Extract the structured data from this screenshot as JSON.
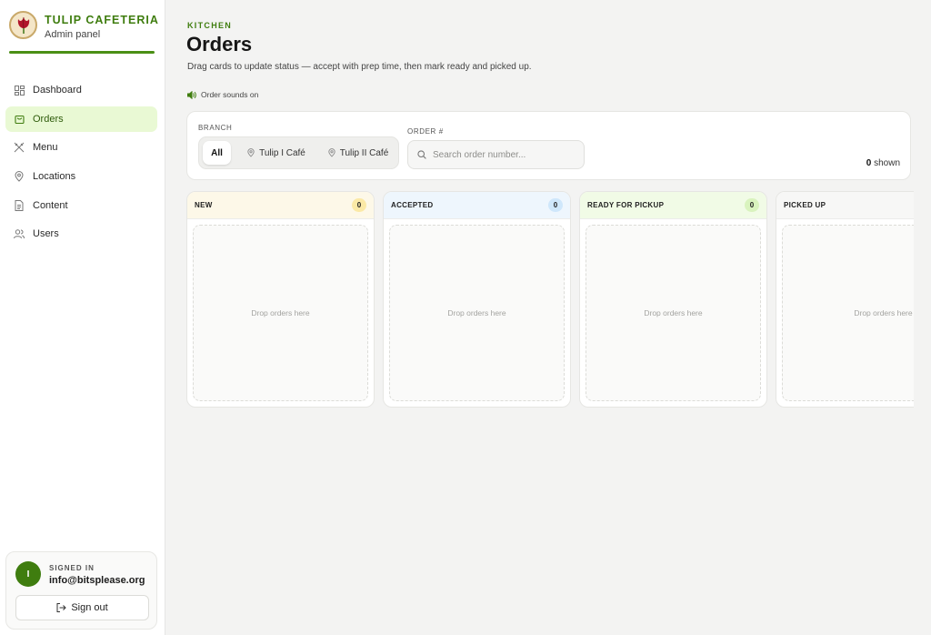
{
  "brand": {
    "name": "TULIP CAFETERIA",
    "subtitle": "Admin panel"
  },
  "nav": [
    {
      "label": "Dashboard",
      "icon": "dashboard-icon",
      "active": false
    },
    {
      "label": "Orders",
      "icon": "shopping-bag-icon",
      "active": true
    },
    {
      "label": "Menu",
      "icon": "utensils-icon",
      "active": false
    },
    {
      "label": "Locations",
      "icon": "map-pin-icon",
      "active": false
    },
    {
      "label": "Content",
      "icon": "document-icon",
      "active": false
    },
    {
      "label": "Users",
      "icon": "users-icon",
      "active": false
    }
  ],
  "user": {
    "avatar_initial": "I",
    "signed_label": "SIGNED IN",
    "email": "info@bitsplease.org",
    "signout_label": "Sign out"
  },
  "header": {
    "kicker": "KITCHEN",
    "title": "Orders",
    "subtitle": "Drag cards to update status — accept with prep time, then mark ready and picked up.",
    "sound_label": "Order sounds on"
  },
  "filters": {
    "branch_label": "BRANCH",
    "branches": [
      "All",
      "Tulip I Café",
      "Tulip II Café"
    ],
    "selected_branch": "All",
    "order_label": "ORDER #",
    "search_placeholder": "Search order number...",
    "shown_count": "0",
    "shown_suffix": "shown"
  },
  "columns": [
    {
      "title": "NEW",
      "count": "0",
      "color": "#fdf8e8",
      "badge": "#fbe9a6",
      "drop_text": "Drop orders here"
    },
    {
      "title": "ACCEPTED",
      "count": "0",
      "color": "#eef6fd",
      "badge": "#cfe7fb",
      "drop_text": "Drop orders here"
    },
    {
      "title": "READY FOR PICKUP",
      "count": "0",
      "color": "#f1fbe6",
      "badge": "#d9f3be",
      "drop_text": "Drop orders here"
    },
    {
      "title": "PICKED UP",
      "count": "",
      "color": "#f7f7f6",
      "badge": "#ececea",
      "drop_text": "Drop orders here"
    }
  ],
  "colors": {
    "accent": "#3f7d0f",
    "active_nav_bg": "#e9f9d4"
  }
}
